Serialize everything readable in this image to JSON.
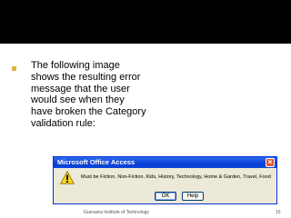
{
  "slide": {
    "bullet_text": "The following image shows the resulting error message that the user would see when they have broken the Category validation rule:",
    "footer": "Guevarra Institute of Technology",
    "page_number": "15"
  },
  "dialog": {
    "title": "Microsoft Office Access",
    "message": "Must be Fiction, Non-Fiction, Kids, History, Technology, Home & Garden, Travel, Food",
    "ok_label": "OK",
    "help_label": "Help",
    "close_glyph": "×"
  },
  "colors": {
    "top_band": "#000000",
    "bullet": "#e3b33c",
    "titlebar": "#0a3fd3",
    "dialog_bg": "#ece9d8"
  },
  "icons": {
    "warning": "warning-icon"
  }
}
